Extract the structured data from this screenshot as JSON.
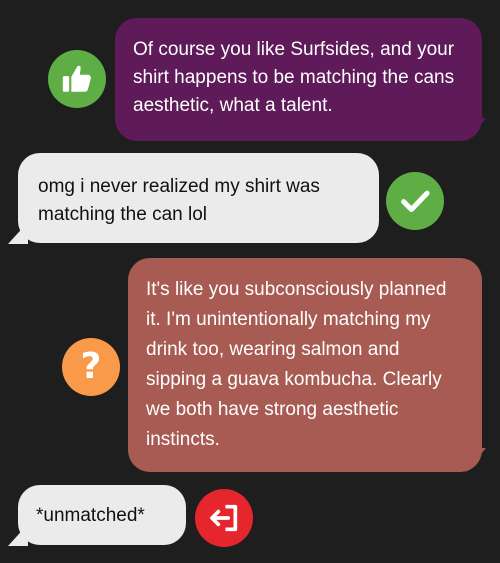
{
  "messages": [
    {
      "sender": "other",
      "text": "Of course you like Surfsides, and your shirt happens to be matching the cans aesthetic, what a talent.",
      "badge_icon": "thumbs-up-icon",
      "bubble_color": "#5e1a59",
      "badge_color": "#5fae45"
    },
    {
      "sender": "user",
      "text": "omg i never realized my shirt was matching the can lol",
      "badge_icon": "checkmark-icon",
      "bubble_color": "#ebebeb",
      "badge_color": "#5fae45"
    },
    {
      "sender": "other",
      "text": "It's like you subconsciously planned it. I'm unintentionally matching my drink too, wearing salmon and sipping a guava kombucha. Clearly we both have strong aesthetic instincts.",
      "badge_icon": "question-mark-icon",
      "bubble_color": "#a85b52",
      "badge_color": "#f99a4a"
    },
    {
      "sender": "user",
      "text": "*unmatched*",
      "badge_icon": "exit-icon",
      "bubble_color": "#ebebeb",
      "badge_color": "#e5262d"
    }
  ],
  "background_color": "#1e1e1e"
}
